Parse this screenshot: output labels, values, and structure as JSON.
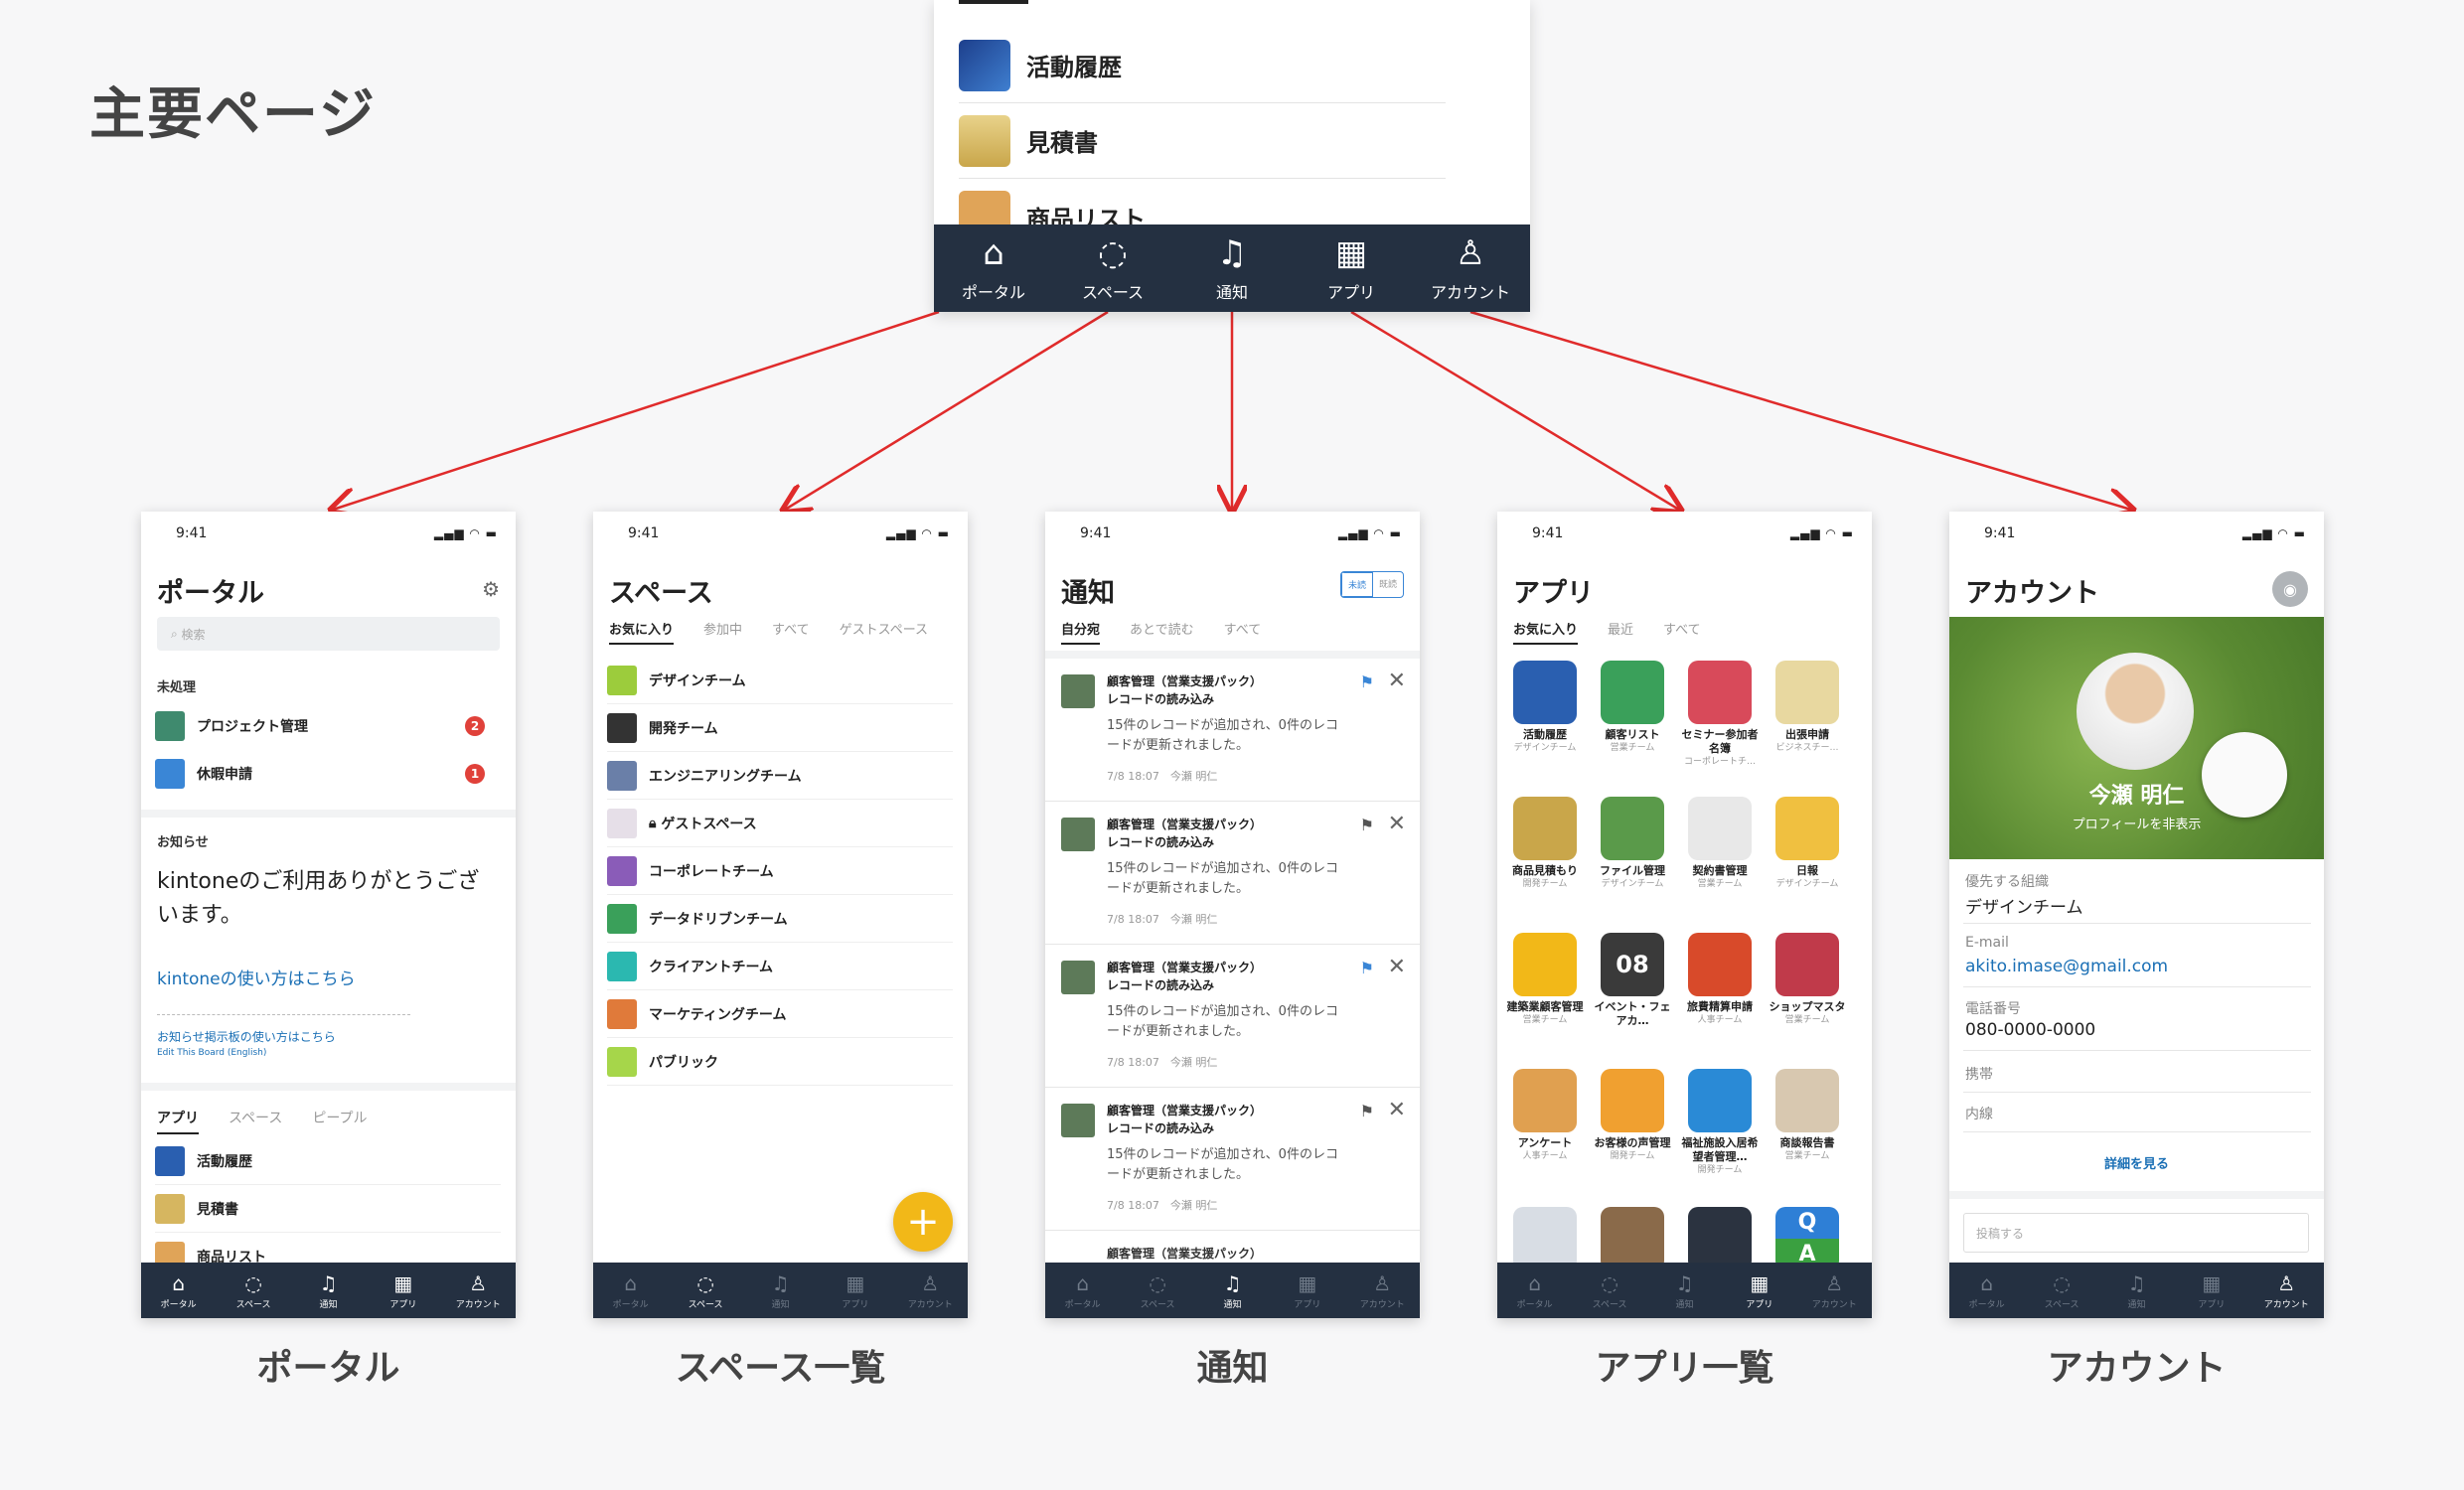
{
  "page_title": "主要ページ",
  "top_panel": {
    "items": [
      "活動履歴",
      "見積書",
      "商品リスト"
    ],
    "tabs": [
      "ポータル",
      "スペース",
      "通知",
      "アプリ",
      "アカウント"
    ]
  },
  "status_time": "9:41",
  "tab_labels": [
    "ポータル",
    "スペース",
    "通知",
    "アプリ",
    "アカウント"
  ],
  "portal": {
    "title": "ポータル",
    "search_placeholder": "検索",
    "pending_label": "未処理",
    "pending": [
      {
        "label": "プロジェクト管理",
        "count": "2"
      },
      {
        "label": "休暇申請",
        "count": "1"
      }
    ],
    "notice_label": "お知らせ",
    "notice_text": "kintoneのご利用ありがとうございます。",
    "link1": "kintoneの使い方はこちら",
    "link2": "お知らせ掲示板の使い方はこちら",
    "link3": "Edit This Board (English)",
    "tabs": [
      "アプリ",
      "スペース",
      "ピープル"
    ],
    "apps": [
      "活動履歴",
      "見積書",
      "商品リスト"
    ],
    "caption": "ポータル"
  },
  "space": {
    "title": "スペース",
    "tabs": [
      "お気に入り",
      "参加中",
      "すべて",
      "ゲストスペース"
    ],
    "items": [
      "デザインチーム",
      "開発チーム",
      "エンジニアリングチーム",
      "ゲストスペース",
      "コーポレートチーム",
      "データドリブンチーム",
      "クライアントチーム",
      "マーケティングチーム",
      "パブリック"
    ],
    "fab": "+",
    "caption": "スペース一覧"
  },
  "notify": {
    "title": "通知",
    "toggle": [
      "未読",
      "既読"
    ],
    "tabs": [
      "自分宛",
      "あとで読む",
      "すべて"
    ],
    "items": [
      {
        "title1": "顧客管理（営業支援パック）",
        "title2": "レコードの読み込み",
        "body1": "15件のレコードが追加され、0件のレコ",
        "body2": "ードが更新されました。",
        "time": "7/8 18:07　今瀬 明仁"
      },
      {
        "title1": "顧客管理（営業支援パック）",
        "title2": "レコードの読み込み",
        "body1": "15件のレコードが追加され、0件のレコ",
        "body2": "ードが更新されました。",
        "time": "7/8 18:07　今瀬 明仁"
      },
      {
        "title1": "顧客管理（営業支援パック）",
        "title2": "レコードの読み込み",
        "body1": "15件のレコードが追加され、0件のレコ",
        "body2": "ードが更新されました。",
        "time": "7/8 18:07　今瀬 明仁"
      },
      {
        "title1": "顧客管理（営業支援パック）",
        "title2": "レコードの読み込み",
        "body1": "15件のレコードが追加され、0件のレコ",
        "body2": "ードが更新されました。",
        "time": "7/8 18:07　今瀬 明仁"
      }
    ],
    "partial": "顧客管理（営業支援パック）",
    "caption": "通知"
  },
  "apps": {
    "title": "アプリ",
    "tabs": [
      "お気に入り",
      "最近",
      "すべて"
    ],
    "items": [
      {
        "name": "活動履歴",
        "team": "デザインチーム"
      },
      {
        "name": "顧客リスト",
        "team": "営業チーム"
      },
      {
        "name": "セミナー参加者名簿",
        "team": "コーポレートチ…"
      },
      {
        "name": "出張申請",
        "team": "ビジネスチー…"
      },
      {
        "name": "商品見積もり",
        "team": "開発チーム"
      },
      {
        "name": "ファイル管理",
        "team": "デザインチーム"
      },
      {
        "name": "契約書管理",
        "team": "営業チーム"
      },
      {
        "name": "日報",
        "team": "デザインチーム"
      },
      {
        "name": "建築業顧客管理",
        "team": "営業チーム"
      },
      {
        "name": "イベント・フェアカ…",
        "team": ""
      },
      {
        "name": "旅費精算申請",
        "team": "人事チーム"
      },
      {
        "name": "ショップマスタ",
        "team": "営業チーム"
      },
      {
        "name": "アンケート",
        "team": "人事チーム"
      },
      {
        "name": "お客様の声管理",
        "team": "開発チーム"
      },
      {
        "name": "福祉施設入居希望者管理…",
        "team": "開発チーム"
      },
      {
        "name": "商談報告書",
        "team": "営業チーム"
      }
    ],
    "cal_day": "08",
    "qa_q": "Q",
    "qa_a": "A",
    "caption": "アプリ一覧"
  },
  "account": {
    "title": "アカウント",
    "name": "今瀬 明仁",
    "hide_profile": "プロフィールを非表示",
    "fields": [
      {
        "label": "優先する組織",
        "value": "デザインチーム"
      },
      {
        "label": "E-mail",
        "value": "akito.imase@gmail.com"
      },
      {
        "label": "電話番号",
        "value": "080-0000-0000"
      },
      {
        "label": "携帯",
        "value": ""
      },
      {
        "label": "内線",
        "value": ""
      }
    ],
    "more": "詳細を見る",
    "post_placeholder": "投稿する",
    "caption": "アカウント"
  },
  "colors": {
    "tabbar": "#243041",
    "arrow": "#e02b2b",
    "fab": "#f2b818",
    "link": "#1a6fb5"
  }
}
